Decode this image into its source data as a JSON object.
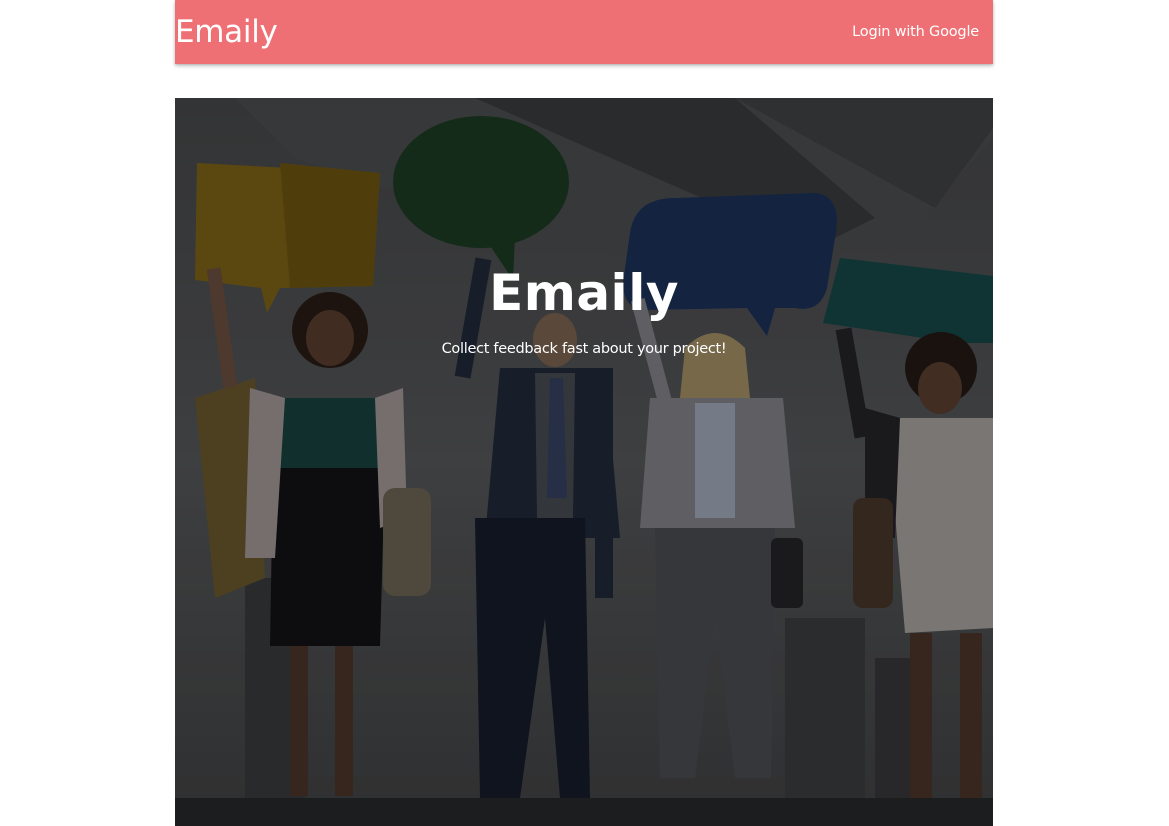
{
  "navbar": {
    "brand": "Emaily",
    "login_label": "Login with Google",
    "background_color": "#ef7074"
  },
  "hero": {
    "title": "Emaily",
    "subtitle": "Collect feedback fast about your project!",
    "image_description_icon": "people-with-speech-bubbles-photo"
  }
}
